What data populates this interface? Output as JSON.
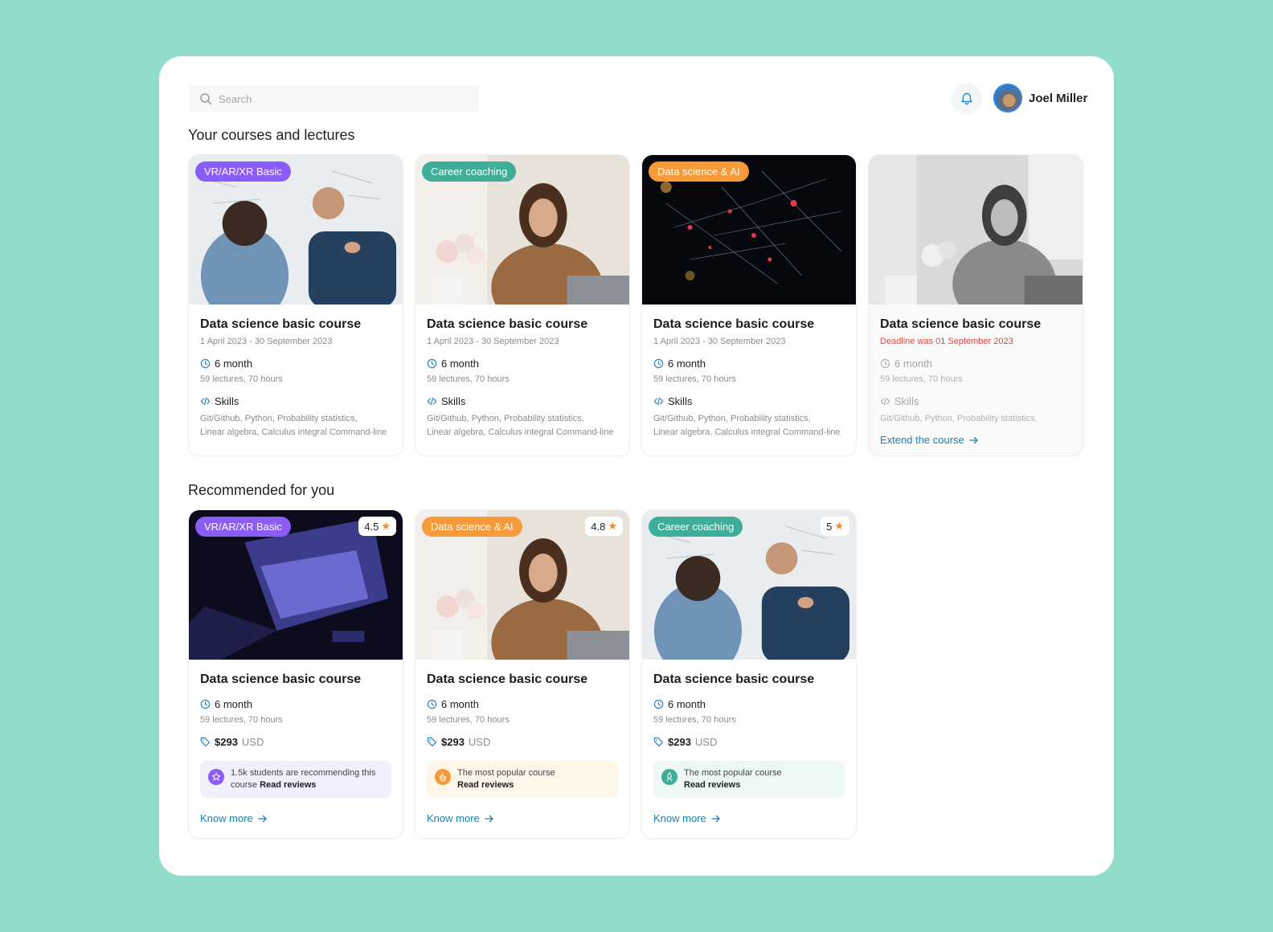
{
  "search": {
    "placeholder": "Search"
  },
  "user": {
    "name": "Joel Miller"
  },
  "sections": {
    "courses_title": "Your courses and lectures",
    "recommended_title": "Recommended for you"
  },
  "colors": {
    "purple": "#8b5cf6",
    "teal": "#3fae98",
    "orange": "#f79a3a",
    "link": "#1d7fb0",
    "deadline": "#e0473c"
  },
  "courses": [
    {
      "badge": "VR/AR/XR Basic",
      "title": "Data science basic course",
      "dates": "1 April 2023 - 30 September 2023",
      "duration": "6 month",
      "lectures": "59 lectures, 70 hours",
      "skills_label": "Skills",
      "skills_line1": "Git/Github,  Python,  Probability statistics,",
      "skills_line2": "Linear algebra,  Calculus integral  Command-line"
    },
    {
      "badge": "Career coaching",
      "title": "Data science basic course",
      "dates": "1 April 2023 - 30 September 2023",
      "duration": "6 month",
      "lectures": "59 lectures, 70 hours",
      "skills_label": "Skills",
      "skills_line1": "Git/Github,  Python,  Probability statistics,",
      "skills_line2": "Linear algebra,  Calculus integral  Command-line"
    },
    {
      "badge": "Data science & AI",
      "title": "Data science basic course",
      "dates": "1 April 2023 - 30 September 2023",
      "duration": "6 month",
      "lectures": "59 lectures, 70 hours",
      "skills_label": "Skills",
      "skills_line1": "Git/Github,  Python,  Probability statistics,",
      "skills_line2": "Linear algebra,  Calculus integral  Command-line"
    },
    {
      "title": "Data science basic course",
      "dates": "Deadline was 01 September 2023",
      "duration": "6 month",
      "lectures": "59 lectures, 70 hours",
      "skills_label": "Skills",
      "skills_line1": "Git/Github,  Python,  Probability statistics,",
      "link": "Extend the course"
    }
  ],
  "recommended": [
    {
      "badge": "VR/AR/XR Basic",
      "rating": "4.5",
      "title": "Data science basic course",
      "duration": "6 month",
      "lectures": "59 lectures, 70 hours",
      "price": "$293",
      "currency": "USD",
      "promo_text": "1.5k students are recommending this course",
      "promo_link": "Read reviews",
      "link": "Know more"
    },
    {
      "badge": "Data science & AI",
      "rating": "4.8",
      "title": "Data science basic course",
      "duration": "6 month",
      "lectures": "59 lectures, 70 hours",
      "price": "$293",
      "currency": "USD",
      "promo_text": "The most popular course",
      "promo_link": "Read reviews",
      "link": "Know more"
    },
    {
      "badge": "Career coaching",
      "rating": "5",
      "title": "Data science basic course",
      "duration": "6 month",
      "lectures": "59 lectures, 70 hours",
      "price": "$293",
      "currency": "USD",
      "promo_text": "The most popular course",
      "promo_link": "Read reviews",
      "link": "Know more"
    }
  ]
}
